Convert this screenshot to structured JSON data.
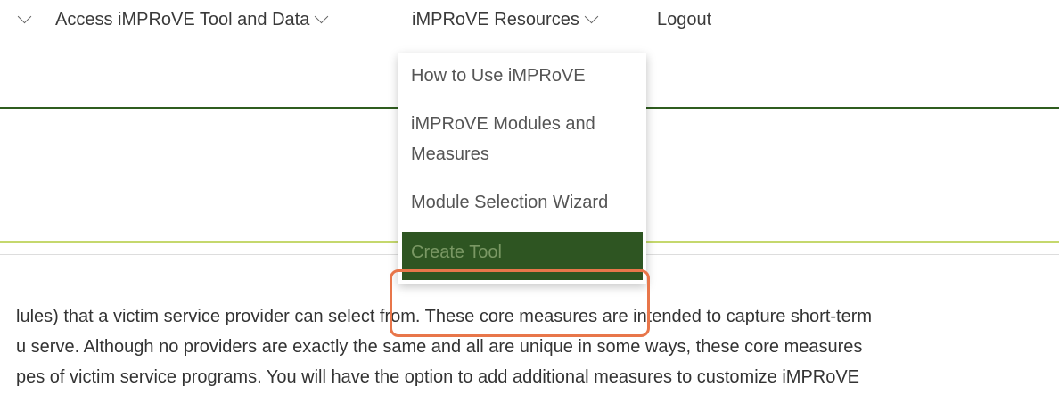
{
  "nav": {
    "items": [
      {
        "label": "Access iMPRoVE Tool and Data"
      },
      {
        "label": "iMPRoVE Resources"
      },
      {
        "label": "Logout"
      }
    ]
  },
  "dropdown": {
    "items": [
      {
        "label": "How to Use iMPRoVE"
      },
      {
        "label": "iMPRoVE Modules and Measures"
      },
      {
        "label": "Module Selection Wizard"
      },
      {
        "label": "Create Tool"
      }
    ]
  },
  "body": {
    "lines": [
      "lules) that a victim service provider can select from. These core measures are intended to capture short-term",
      "u serve. Although no providers are exactly the same and all are unique in some ways, these core measures",
      "pes of victim service programs. You will have the option to add additional measures to customize iMPRoVE"
    ]
  },
  "colors": {
    "dark_green_rule": "#2f5d1f",
    "lime_rule": "#c5d86d",
    "active_item_bg": "#2e5522",
    "highlight_ring": "#e8764a"
  }
}
